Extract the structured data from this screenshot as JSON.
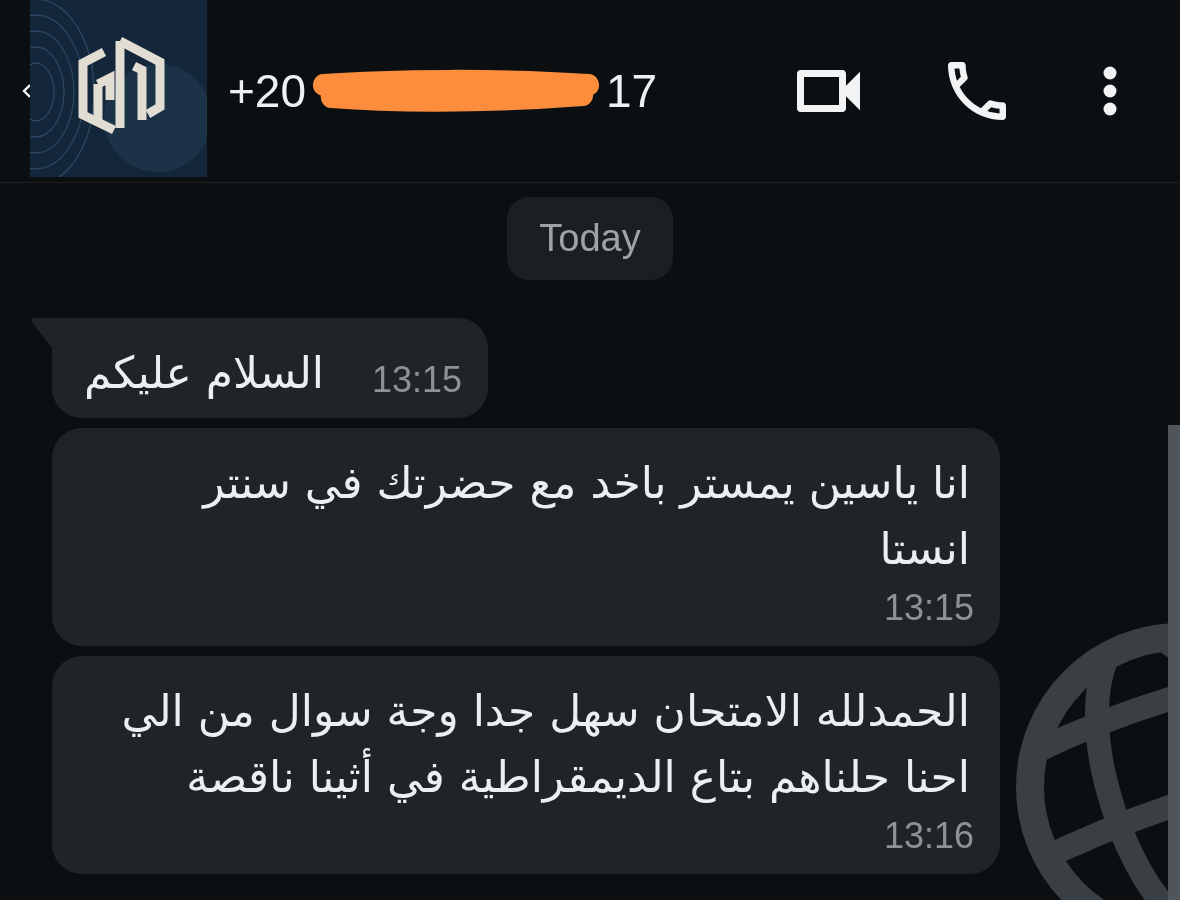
{
  "header": {
    "contact_number": {
      "start": "+20",
      "end": "17"
    }
  },
  "date_chip": "Today",
  "messages": [
    {
      "text": "السلام عليكم",
      "time": "13:15",
      "tail": true
    },
    {
      "text": "انا ياسين يمستر باخد مع حضرتك في سنتر انستا",
      "time": "13:15",
      "tail": false
    },
    {
      "text": "الحمدلله الامتحان سهل جدا وجة سوال من الي احنا حلناهم بتاع الديمقراطية في أثينا ناقصة",
      "time": "13:16",
      "tail": false
    }
  ]
}
